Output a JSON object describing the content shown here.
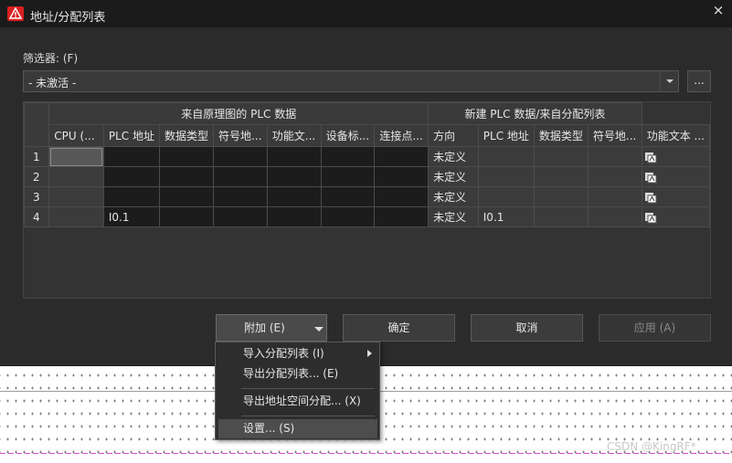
{
  "window": {
    "title": "地址/分配列表",
    "close_glyph": "×"
  },
  "filter": {
    "label": "筛选器: (F)",
    "value": "- 未激活 -",
    "more_label": "..."
  },
  "grid": {
    "group_left": "来自原理图的 PLC 数据",
    "group_right": "新建 PLC 数据/来自分配列表",
    "columns": [
      "CPU (...",
      "PLC 地址",
      "数据类型",
      "符号地...",
      "功能文...",
      "设备标...",
      "连接点...",
      "方向",
      "PLC 地址",
      "数据类型",
      "符号地...",
      "功能文本 ..."
    ],
    "rows": [
      {
        "num": "1",
        "plc_addr": "",
        "direction": "未定义",
        "new_addr": ""
      },
      {
        "num": "2",
        "plc_addr": "",
        "direction": "未定义",
        "new_addr": ""
      },
      {
        "num": "3",
        "plc_addr": "",
        "direction": "未定义",
        "new_addr": ""
      },
      {
        "num": "4",
        "plc_addr": "I0.1",
        "direction": "未定义",
        "new_addr": "I0.1"
      }
    ]
  },
  "buttons": {
    "attach": "附加 (E)",
    "ok": "确定",
    "cancel": "取消",
    "apply": "应用 (A)"
  },
  "menu": {
    "items": [
      "导入分配列表 (I)",
      "导出分配列表... (E)",
      "导出地址空间分配... (X)",
      "设置... (S)"
    ]
  },
  "watermark": "CSDN @KingRF*",
  "colors": {
    "titlebar": "#1b1b1b",
    "dialog": "#2b2b2b",
    "cell_dark": "#1c1c1c",
    "app_icon": "#d92020"
  }
}
